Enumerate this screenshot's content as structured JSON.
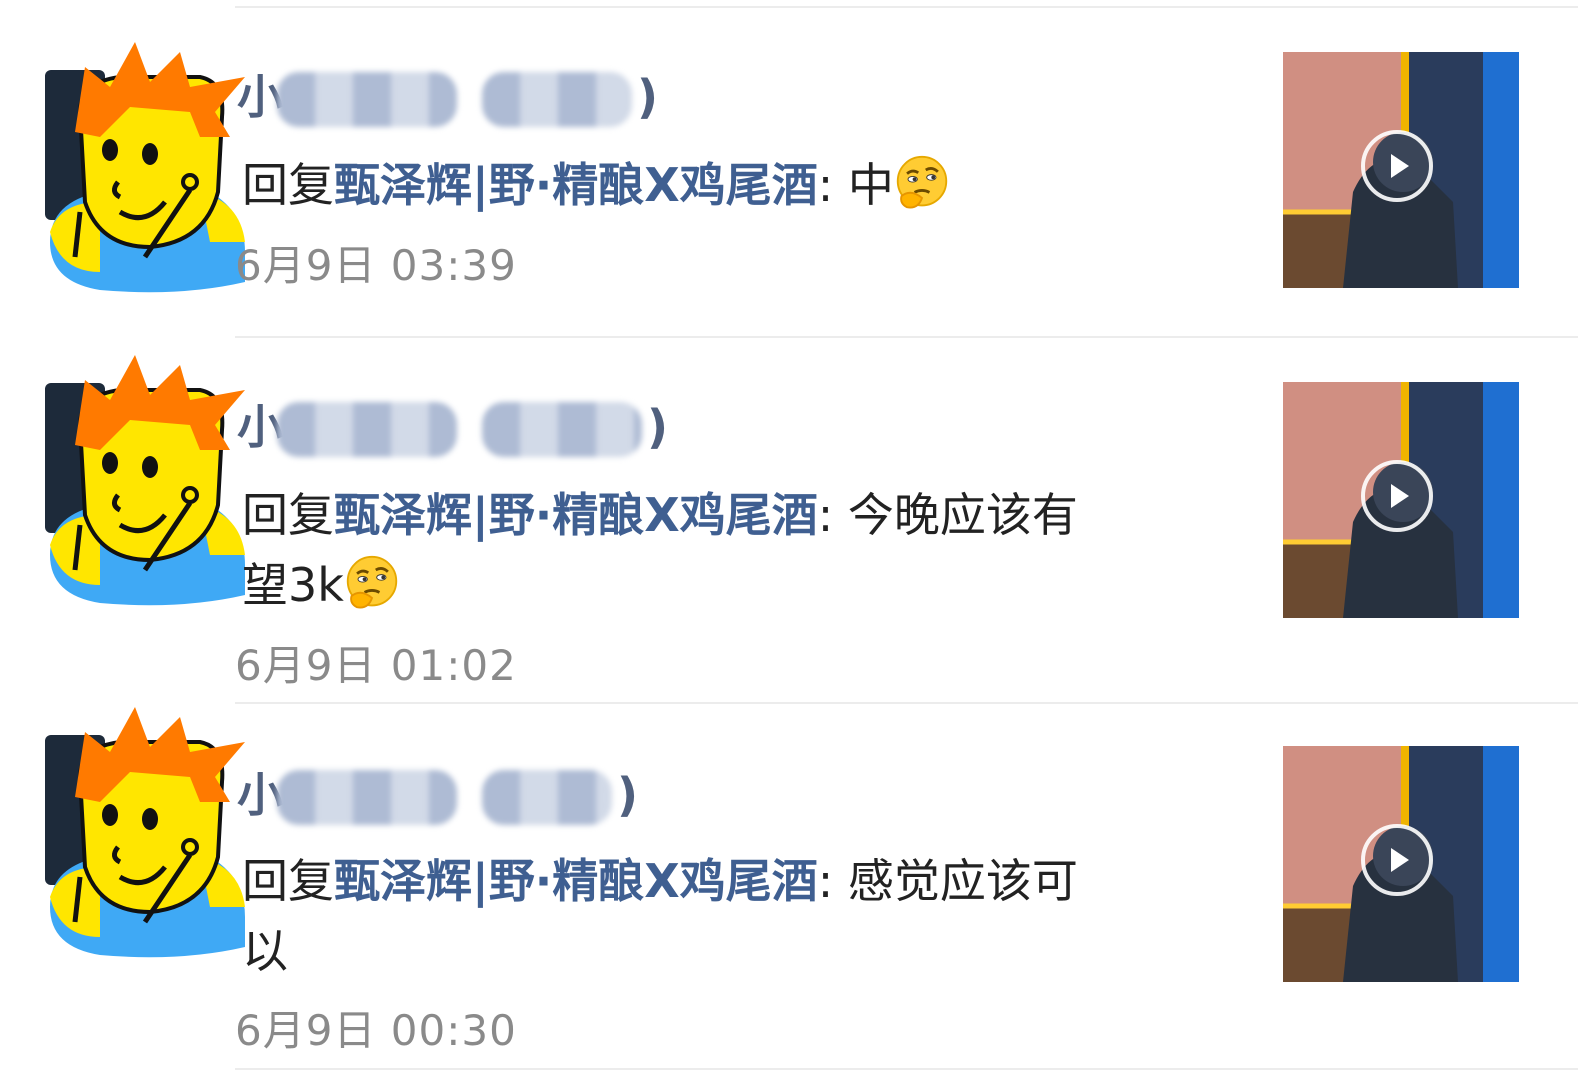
{
  "comments": [
    {
      "name_prefix": "小",
      "name_suffix": ")",
      "reply_label": "回复",
      "reply_target": "甄泽辉|野·精酿X鸡尾酒",
      "separator": ": ",
      "text_line1": "中",
      "text_line2": "",
      "time": "6月9日 03:39"
    },
    {
      "name_prefix": "小",
      "name_suffix": ")",
      "reply_label": "回复",
      "reply_target": "甄泽辉|野·精酿X鸡尾酒",
      "separator": ": ",
      "text_line1": "今晚应该有",
      "text_line2": "望3k",
      "time": "6月9日 01:02"
    },
    {
      "name_prefix": "小",
      "name_suffix": ")",
      "reply_label": "回复",
      "reply_target": "甄泽辉|野·精酿X鸡尾酒",
      "separator": ": ",
      "text_line1": "感觉应该可",
      "text_line2": "以",
      "time": "6月9日 00:30"
    }
  ],
  "icons": {
    "avatar": "cartoon-avatar-icon",
    "emoji": "thinking-emoji-icon",
    "play": "play-icon"
  },
  "colors": {
    "link": "#3f5f91",
    "name": "#50607e",
    "time": "#8a8a8a",
    "avatar_hair": "#ff7a00",
    "avatar_face": "#ffe600",
    "avatar_shirt": "#3fa9f5"
  }
}
